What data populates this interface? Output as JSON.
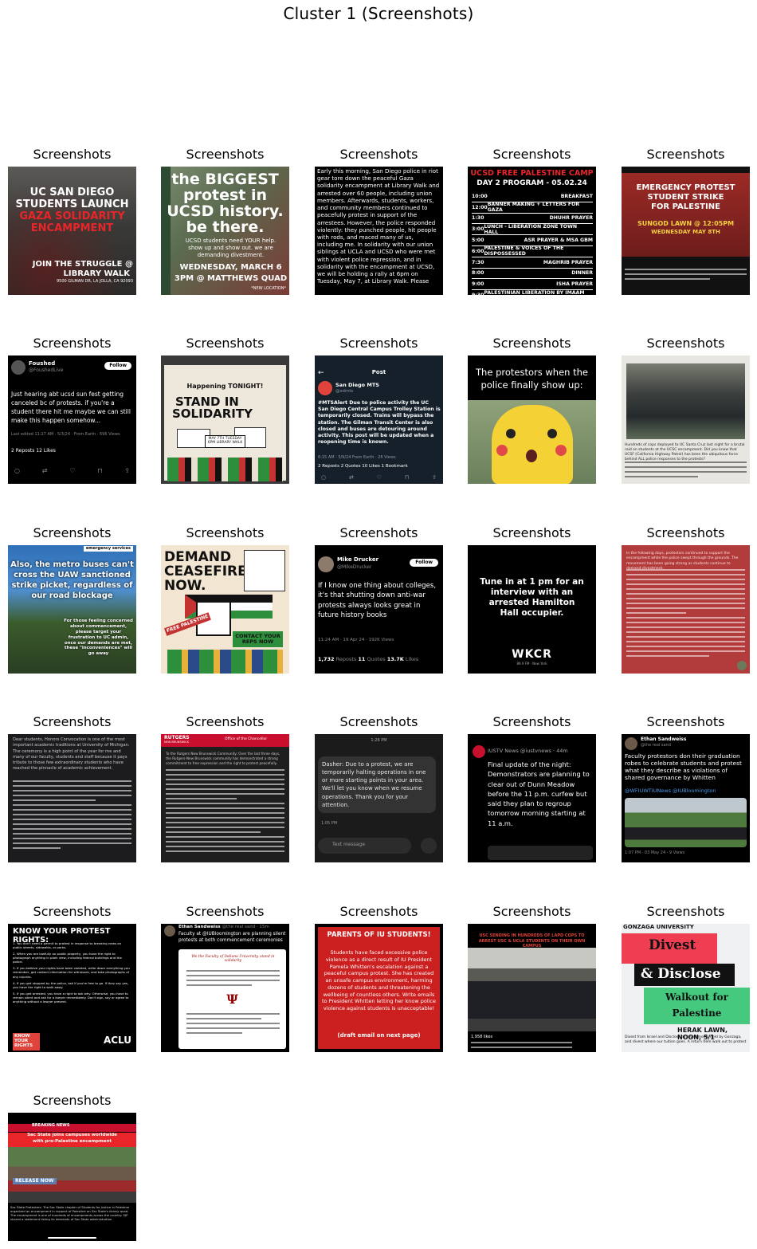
{
  "figure_title": "Cluster 1 (Screenshots)",
  "caption": "Screenshots",
  "thumbs": {
    "t1": {
      "l1": "UC SAN DIEGO",
      "l2": "STUDENTS LAUNCH",
      "l3": "GAZA SOLIDARITY",
      "l4": "ENCAMPMENT",
      "l5": "JOIN THE STRUGGLE @",
      "l6": "LIBRARY WALK",
      "l7": "9500 GILMAN DR, LA JOLLA, CA 92093"
    },
    "t2": {
      "l1": "the BIGGEST",
      "l2": "protest in",
      "l3": "UCSD history.",
      "l4": "be there.",
      "l5": "UCSD students need YOUR help.",
      "l6": "show up and show out. we are",
      "l7": "demanding divestment.",
      "l8": "WEDNESDAY, MARCH 6",
      "l9": "3PM @ MATTHEWS QUAD",
      "l10": "*NEW LOCATION*"
    },
    "t3": {
      "text": "Early this morning, San Diego police in riot gear tore down the peaceful Gaza solidarity encampment at Library Walk and arrested over 60 people, including union members. Afterwards, students, workers, and community members continued to peacefully protest in support of the arrestees. However, the police responded violently: they punched people, hit people with rods, and maced many of us, including me. In solidarity with our union siblings at UCLA and UCSD who were met with violent police repression, and in solidarity with the encampment at UCSD, we will be holding a rally at 6pm on Tuesday, May 7, at Library Walk. Please"
    },
    "t4": {
      "title": "UCSD FREE PALESTINE CAMP",
      "sub": "DAY 2 PROGRAM - 05.02.24",
      "rows": [
        [
          "10:00",
          "BREAKFAST"
        ],
        [
          "12:00",
          "BANNER MAKING + LETTERS FOR GAZA"
        ],
        [
          "1:30",
          "DHUHR PRAYER"
        ],
        [
          "3:00",
          "LUNCH - LIBERATION ZONE TOWN HALL"
        ],
        [
          "5:00",
          "ASR PRAYER & MSA GBM"
        ],
        [
          "6:00",
          "PALESTINE & VOICES OF THE DISPOSSESSED"
        ],
        [
          "7:30",
          "MAGHRIB PRAYER"
        ],
        [
          "8:00",
          "DINNER"
        ],
        [
          "9:00",
          "ISHA PRAYER"
        ],
        [
          "9:30",
          "PALESTINIAN LIBERATION BY IMAAM TOM"
        ]
      ]
    },
    "t5": {
      "l1": "EMERGENCY PROTEST",
      "l2": "STUDENT STRIKE",
      "l3": "FOR PALESTINE",
      "l4": "SUNGOD LAWN @ 12:05PM",
      "l5": "WEDNESDAY MAY 8TH"
    },
    "t6": {
      "name": "Foushed",
      "handle": "@FoushedLive",
      "follow": "Follow",
      "text": "Just hearing abt ucsd sun fest getting canceled bc of protests. if you're a student there hit me maybe we can still make this happen somehow...",
      "meta": "Last edited 11:27 AM · 5/3/24 · From Earth · 696 Views",
      "stats": "2 Reposts 12 Likes"
    },
    "t7": {
      "top": "Happening TONIGHT!",
      "l1": "STAND IN",
      "l2": "SOLIDARITY",
      "sign": "MAY 7TH TUESDAY 6PM LIBRARY WALK"
    },
    "t8": {
      "header": "Post",
      "name": "San Diego MTS",
      "handle": "@sdmts",
      "text": "#MTSAlert Due to police activity the UC San Diego Central Campus Trolley Station is temporarily closed. Trains will bypass the station. The Gilman Transit Center is also closed and buses are detouring around activity. This post will be updated when a reopening time is known.",
      "meta": "6:15 AM · 5/9/24 From Earth · 26 Views",
      "stats": "2 Reposts 2 Quotes 10 Likes 1 Bookmark"
    },
    "t9": {
      "text": "The protestors when the police finally show up:"
    },
    "t10": {
      "text": "Hundreds of cops deployed to UC Santa Cruz last night for a brutal raid on students at the UCSC encampment. Did you know that UCSF (California Highway Patrol) has been the ubiquitous force behind ALL police responses to the protests?"
    },
    "t11": {
      "tag": "emergency services",
      "text": "Also, the metro buses can't cross the UAW sanctioned strike picket, regardless of our road blockage",
      "text2": "For those feeling concerned about commencement, please target your frustration to UC admin, once our demands are met, these \"inconveniences\" will go away"
    },
    "t12": {
      "l1": "DEMAND",
      "l2": "CEASEFIRE",
      "l3": "NOW.",
      "flag": "FREE PALESTINE",
      "sign": "CONTACT YOUR REPS NOW"
    },
    "t13": {
      "name": "Mike Drucker",
      "handle": "@MikeDrucker",
      "follow": "Follow",
      "text": "If I know one thing about colleges, it's that shutting down anti-war protests always looks great in future history books",
      "meta": "11:24 AM · 19 Apr 24 · 192K Views",
      "stats1": "1,732",
      "stats1l": "Reposts",
      "stats2": "11",
      "stats2l": "Quotes",
      "stats3": "13.7K",
      "stats3l": "Likes"
    },
    "t14": {
      "text": "Tune in at 1 pm for an interview with an arrested Hamilton Hall occupier.",
      "logo": "WKCR",
      "sub": "89.9 FM · New York"
    },
    "t15": {
      "text": "In the following days, protestors continued to support the encampment while the police swept through the grounds. The movement has been going strong as students continue to demand divestment."
    },
    "t16": {
      "text": "Dear students, Honors Convocation is one of the most important academic traditions at University of Michigan. The ceremony is a high point of the year for me and many of our faculty, students and staff because it pays tribute to those few extraordinary students who have reached the pinnacle of academic achievement."
    },
    "t17": {
      "logo": "RUTGERS",
      "sub": "NEW BRUNSWICK",
      "office": "Office of the Chancellor",
      "text": "To the Rutgers New Brunswick Community: Over the last three days, the Rutgers-New Brunswick community has demonstrated a strong commitment to free expression and the right to protest peacefully."
    },
    "t18": {
      "time": "1:26 PM",
      "text": "Dasher: Due to a protest, we are temporarily halting operations in one or more starting points in your area. We'll let you know when we resume operations. Thank you for your attention.",
      "stamp": "1:05 PM",
      "input": "Text message"
    },
    "t19": {
      "handle": "IUSTV News @iustvnews · 44m",
      "text": "Final update of the night: Demonstrators are planning to clear out of Dunn Meadow before the 11 p.m. curfew but said they plan to regroup tomorrow morning starting at 11 a.m."
    },
    "t20": {
      "name": "Ethan Sandweiss",
      "handle": "@the real sand",
      "text": "Faculty protestors don their graduation robes to celebrate students and protest what they describe as violations of shared governance by Whitten",
      "tags": "@WFIUWTIUNews @IUBloomington",
      "meta": "1:07 PM · 03 May 24 · 9 Views"
    },
    "t21": {
      "title": "KNOW YOUR PROTEST RIGHTS:",
      "items": [
        "1. You don't need a permit to protest in response to breaking news on public streets, sidewalks, or parks.",
        "2. When you are lawfully on public property, you have the right to photograph anything in plain view, including federal buildings and the police.",
        "3. If you believe your rights have been violated, write down everything you remember, get contact information for witnesses, and take photographs of any injuries.",
        "4. If you get stopped by the police, ask if you're free to go. If they say yes, you have the right to walk away.",
        "5. If you get arrested, you have a right to ask why. Otherwise, you have to remain silent and ask for a lawyer immediately. Don't sign, say or agree to anything without a lawyer present."
      ],
      "badge": "KNOW YOUR RIGHTS",
      "logo": "ACLU"
    },
    "t22": {
      "name": "Ethan Sandweiss",
      "handle": "@the real sand · 15m",
      "text": "Faculty at @IUBloomington are planning silent protests at both commencement ceremonies",
      "letter": "We the Faculty of Indiana University, stand in solidarity"
    },
    "t23": {
      "title": "PARENTS OF IU STUDENTS!",
      "text": "Students have faced excessive police violence as a direct result of IU President Pamela Whitten's escalation against a peaceful campus protest. She has created an unsafe campus environment, harming dozens of students and threatening the wellbeing of countless others. Write emails to President Whitten letting her know police violence against students is unacceptable!",
      "foot": "(draft email on next page)"
    },
    "t24": {
      "banner": "USC SENDING IN HUNDREDS OF LAPD COPS TO ARREST USC & UCLA STUDENTS ON THEIR OWN CAMPUS",
      "likes": "1,958 likes"
    },
    "t25": {
      "top": "GONZAGA UNIVERSITY",
      "l1": "Divest",
      "l2": "& Disclose",
      "l3": "Walkout for",
      "l4": "Palestine",
      "l5": "HERAK LAWN, NOON, 5/1",
      "l6": "Divest from Israel and Disclose all investments held by Gonzaga, and divest where our tuition goes. A return item walk out to protest"
    },
    "t26": {
      "top": "BREAKING NEWS",
      "l1": "Sac State joins campuses worldwide",
      "l2": "with pro-Palestine encampment",
      "sign": "RELEASE NOW",
      "cap": "Sac State Protesters: The Sac State chapter of Students for Justice in Palestine organized an encampment in support of Palestine on Sac State's library quad. The encampment is one of hundreds of encampments across the country. SJP shared a statement listing its demands of Sac State administration."
    }
  }
}
